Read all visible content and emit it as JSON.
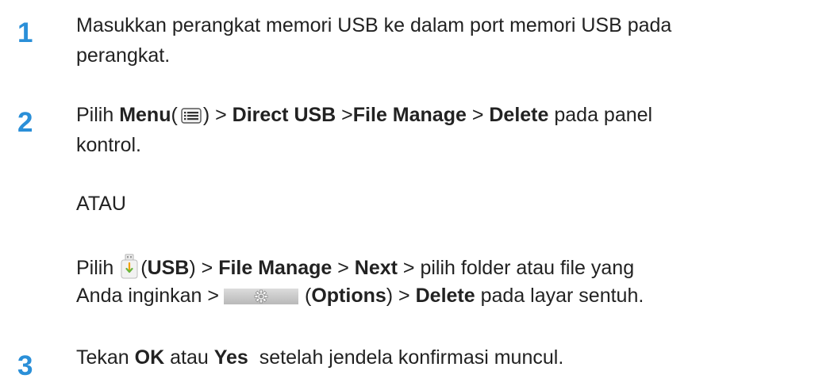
{
  "colors": {
    "step_number": "#2a8fd8",
    "text": "#222222"
  },
  "steps": [
    {
      "number": "1",
      "line1": "Masukkan perangkat memori USB ke dalam port memori USB pada",
      "line2": "perangkat."
    },
    {
      "number": "2",
      "pilih": "Pilih",
      "menu": "Menu",
      "paren_open": "(",
      "menu_icon": "menu-icon",
      "after_menu": ") > ",
      "direct_usb": "Direct USB",
      "sep1": " >",
      "file_manage": "File Manage",
      "sep2": " > ",
      "delete": "Delete",
      "tail": " pada panel",
      "line2": "kontrol.",
      "or_text": "ATAU",
      "alt": {
        "pilih": "Pilih",
        "usb_icon": "usb-stick-icon",
        "paren_open": "(",
        "usb": "USB",
        "after_usb": ") > ",
        "file_manage": "File Manage",
        "sep1": " > ",
        "next": "Next",
        "tail": " > pilih folder atau file yang",
        "line2_start": "Anda inginkan >",
        "options_icon": "gear-icon",
        "paren_open2": "(",
        "options": "Options",
        "after_options": ") > ",
        "delete": "Delete",
        "line2_end": " pada layar sentuh."
      }
    },
    {
      "number": "3",
      "tekan": "Tekan ",
      "ok": "OK",
      "atau": " atau ",
      "yes": "Yes",
      "tail": "  setelah jendela konfirmasi muncul."
    }
  ]
}
